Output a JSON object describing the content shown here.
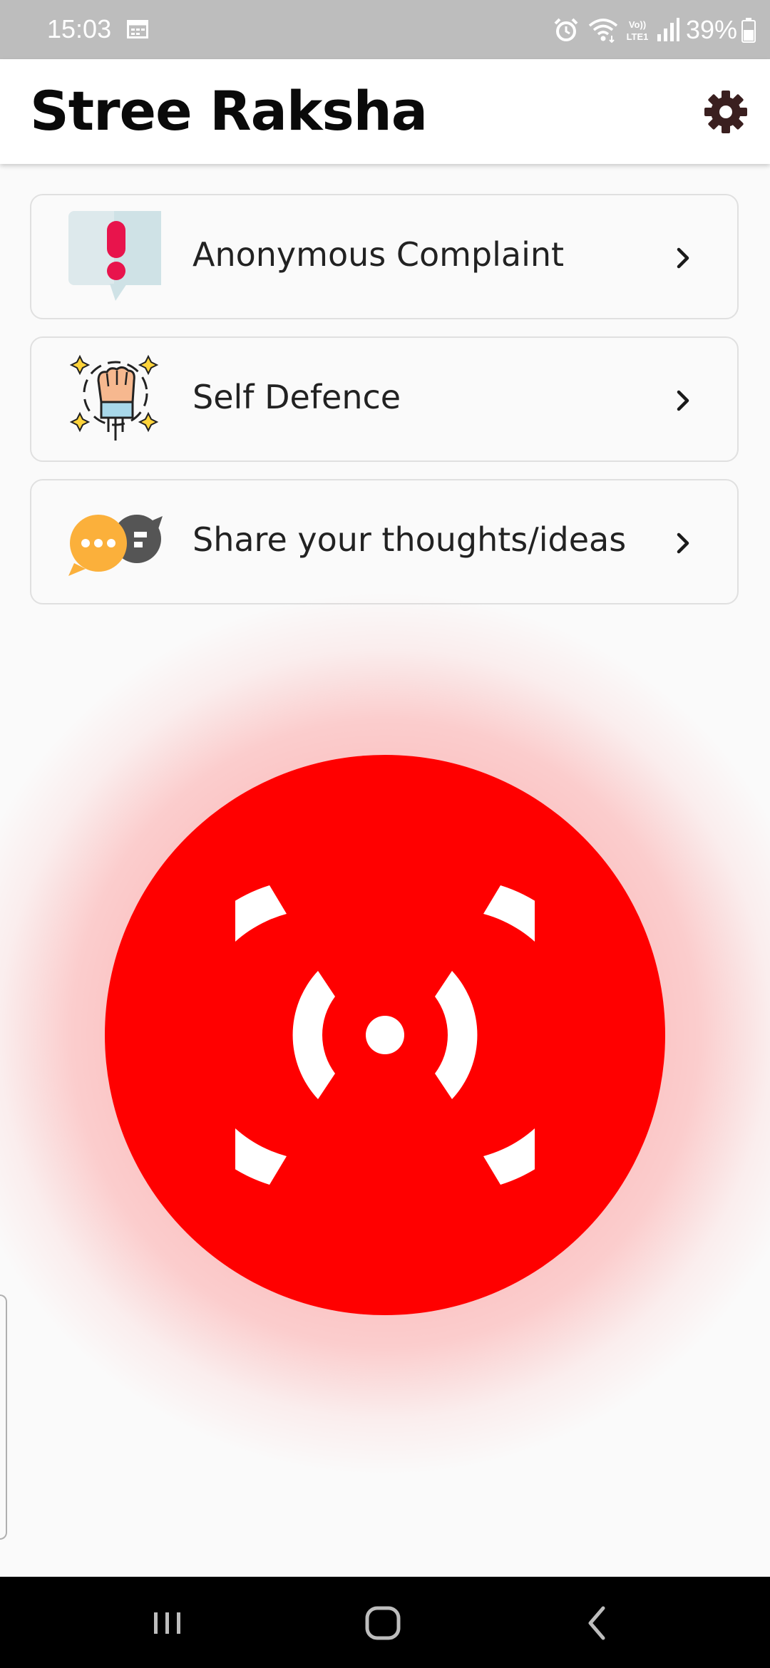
{
  "status_bar": {
    "time": "15:03",
    "battery": "39%",
    "icons": [
      "calendar-icon",
      "alarm-icon",
      "wifi-icon",
      "volte-icon",
      "signal-icon",
      "battery-icon"
    ]
  },
  "app_bar": {
    "title": "Stree Raksha",
    "settings_icon": "gear-icon"
  },
  "menu": {
    "items": [
      {
        "label": "Anonymous Complaint",
        "icon": "alert-speech-bubble-icon"
      },
      {
        "label": "Self Defence",
        "icon": "raised-fist-icon"
      },
      {
        "label": "Share your thoughts/ideas",
        "icon": "chat-bubbles-icon"
      }
    ]
  },
  "sos": {
    "icon": "broadcast-signal-icon",
    "color": "#ff0000"
  },
  "nav_bar": {
    "buttons": [
      "recent-apps-icon",
      "home-icon",
      "back-icon"
    ]
  }
}
